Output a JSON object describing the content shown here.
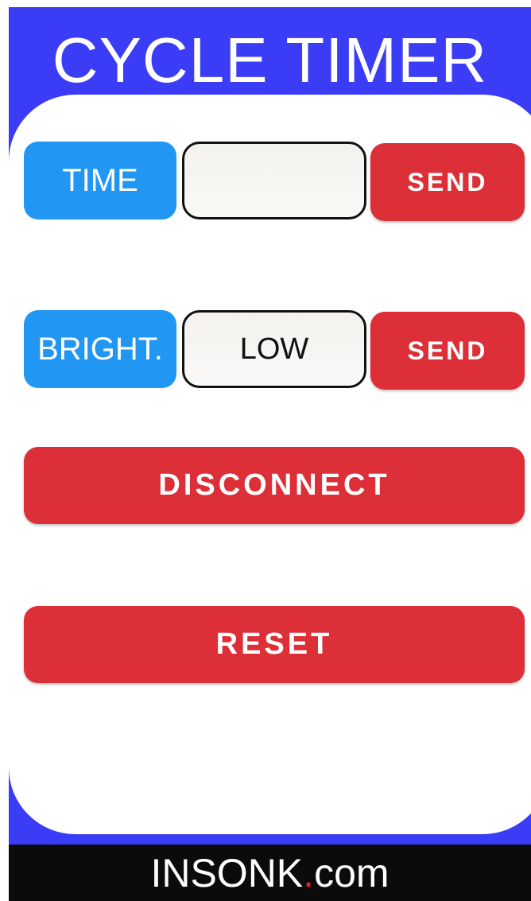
{
  "app": {
    "title": "CYCLE TIMER"
  },
  "time_row": {
    "label": "TIME",
    "input_value": "",
    "send_label": "SEND"
  },
  "brightness_row": {
    "label": "BRIGHT.",
    "input_value": "LOW",
    "send_label": "SEND"
  },
  "actions": {
    "disconnect_label": "DISCONNECT",
    "reset_label": "RESET"
  },
  "footer": {
    "brand_name": "INSONK",
    "brand_dot": ".",
    "brand_tld": "com"
  },
  "colors": {
    "frame_blue": "#3a3df5",
    "label_blue": "#2196f3",
    "button_red": "#dc2f37",
    "footer_black": "#0b0b0b"
  }
}
